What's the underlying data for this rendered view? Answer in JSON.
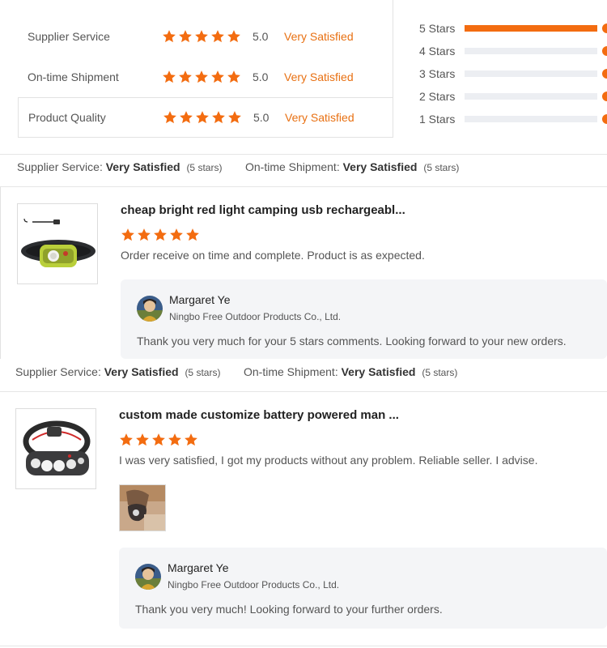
{
  "summary": {
    "rows": [
      {
        "label": "Supplier Service",
        "score": "5.0",
        "status": "Very Satisfied",
        "stars": 5
      },
      {
        "label": "On-time Shipment",
        "score": "5.0",
        "status": "Very Satisfied",
        "stars": 5
      },
      {
        "label": "Product Quality",
        "score": "5.0",
        "status": "Very Satisfied",
        "stars": 5
      }
    ]
  },
  "histogram": [
    {
      "label": "5  Stars",
      "fraction": 1.0
    },
    {
      "label": "4  Stars",
      "fraction": 0
    },
    {
      "label": "3  Stars",
      "fraction": 0
    },
    {
      "label": "2  Stars",
      "fraction": 0
    },
    {
      "label": "1  Stars",
      "fraction": 0
    }
  ],
  "reviews": [
    {
      "supplier_service_label": "Supplier Service:",
      "supplier_service_value": "Very Satisfied",
      "supplier_service_stars": "(5 stars)",
      "shipment_label": "On-time Shipment:",
      "shipment_value": "Very Satisfied",
      "shipment_stars": "(5 stars)",
      "product_title": "cheap bright red light camping usb rechargeabl...",
      "rating": 5,
      "text": "Order receive on time and complete. Product is as expected.",
      "reply": {
        "name": "Margaret Ye",
        "company": "Ningbo Free Outdoor Products Co., Ltd.",
        "text": "Thank you very much for your 5 stars comments. Looking forward to your new orders."
      }
    },
    {
      "supplier_service_label": "Supplier Service:",
      "supplier_service_value": "Very Satisfied",
      "supplier_service_stars": "(5 stars)",
      "shipment_label": "On-time Shipment:",
      "shipment_value": "Very Satisfied",
      "shipment_stars": "(5 stars)",
      "product_title": "custom made customize battery powered man ...",
      "rating": 5,
      "text": "I was very satisfied, I got my products without any problem. Reliable seller. I advise.",
      "reply": {
        "name": "Margaret Ye",
        "company": "Ningbo Free Outdoor Products Co., Ltd.",
        "text": "Thank you very much! Looking forward to your further orders."
      }
    }
  ],
  "colors": {
    "accent": "#f36c10",
    "star": "#f36c10",
    "status_text": "#e87012"
  },
  "icons": [
    "star-icon",
    "avatar-image",
    "headlamp-product-image",
    "review-photo"
  ]
}
